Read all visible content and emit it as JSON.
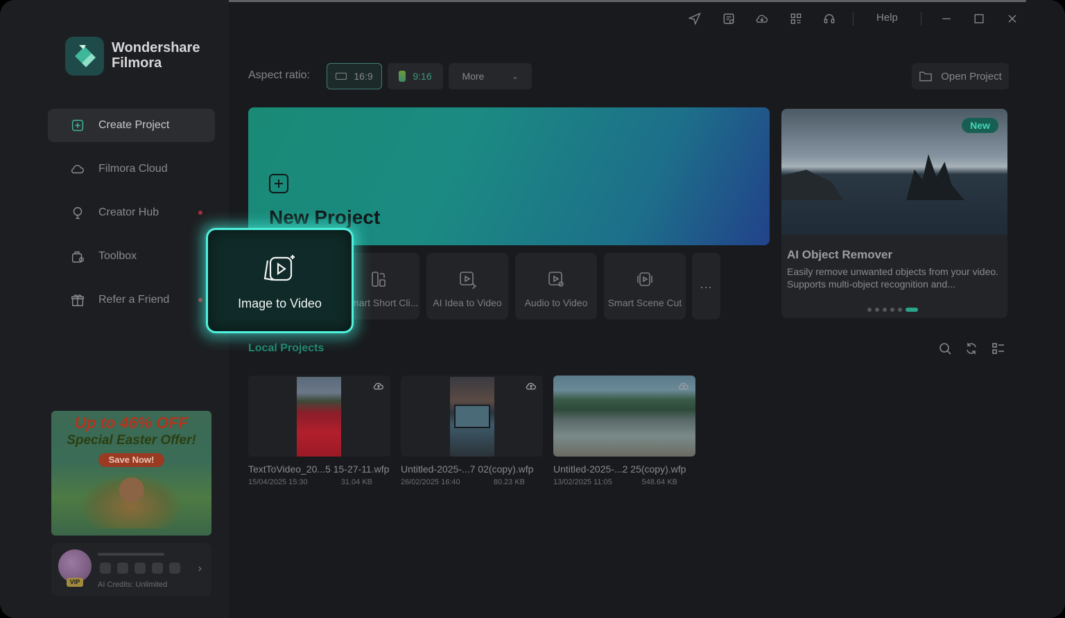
{
  "app": {
    "name_line1": "Wondershare",
    "name_line2": "Filmora"
  },
  "titlebar": {
    "help": "Help"
  },
  "sidebar": {
    "items": [
      {
        "label": "Create Project",
        "icon": "plus-square-icon",
        "active": true
      },
      {
        "label": "Filmora Cloud",
        "icon": "cloud-icon"
      },
      {
        "label": "Creator Hub",
        "icon": "lightbulb-icon",
        "badge": true
      },
      {
        "label": "Toolbox",
        "icon": "toolbox-icon"
      },
      {
        "label": "Refer a Friend",
        "icon": "gift-icon",
        "badge": true
      }
    ],
    "promo": {
      "line1": "Up to 46% OFF",
      "line2": "Special Easter Offer!",
      "button": "Save Now!"
    },
    "user": {
      "vip": "VIP",
      "credits": "AI Credits: Unlimited"
    }
  },
  "aspect_ratio": {
    "label": "Aspect ratio:",
    "options": [
      "16:9",
      "9:16"
    ],
    "selected": "16:9",
    "more": "More"
  },
  "open_project": "Open Project",
  "new_project": {
    "title": "New Project"
  },
  "tiles": [
    {
      "label": "Image to Video",
      "icon": "image-to-video-icon",
      "highlighted": true
    },
    {
      "label": "Smart Short Cli...",
      "icon": "smart-short-clips-icon"
    },
    {
      "label": "AI Idea to Video",
      "icon": "ai-idea-icon"
    },
    {
      "label": "Audio to Video",
      "icon": "audio-to-video-icon"
    },
    {
      "label": "Smart Scene Cut",
      "icon": "scene-cut-icon"
    }
  ],
  "tile_more": "...",
  "feature_card": {
    "badge": "New",
    "title": "AI Object Remover",
    "description": "Easily remove unwanted objects from your video. Supports multi-object recognition and..."
  },
  "local_projects": {
    "title": "Local Projects",
    "items": [
      {
        "name": "TextToVideo_20...5 15-27-11.wfp",
        "date": "15/04/2025 15:30",
        "size": "31.04 KB"
      },
      {
        "name": "Untitled-2025-...7 02(copy).wfp",
        "date": "26/02/2025 16:40",
        "size": "80.23 KB"
      },
      {
        "name": "Untitled-2025-...2 25(copy).wfp",
        "date": "13/02/2025 11:05",
        "size": "548.64 KB"
      }
    ]
  },
  "colors": {
    "accent": "#1f8a72",
    "highlight": "#4ff2dd",
    "background": "#191a1d",
    "sidebar": "#1d1e21"
  }
}
